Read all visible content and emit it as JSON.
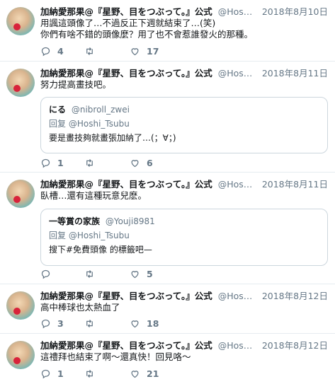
{
  "author": {
    "name": "加納愛那果@『星野、目をつぶって。』公式",
    "handle": "@Hos…"
  },
  "reply_prefix": "回复",
  "tweets": [
    {
      "date": "2018年8月10日",
      "text": "用諷這頭像了…不過反正下週就結束了…(笑)\n你們有啥不錯的頭像麼？用了也不會惹誰發火的那種。",
      "replies": "4",
      "retweets": "",
      "likes": "17"
    },
    {
      "date": "2018年8月11日",
      "text": "努力提高畫技吧。",
      "quote": {
        "name": "にる",
        "handle": "@nibroll_zwei",
        "reply_to": "@Hoshi_Tsubu",
        "text": "要是畫技夠就畫張加納了…(；∀；)"
      },
      "replies": "1",
      "retweets": "",
      "likes": "6"
    },
    {
      "date": "2018年8月11日",
      "text": "臥槽…還有這種玩意兒麽。",
      "quote": {
        "name": "一等賞の家族",
        "handle": "@Youji8981",
        "reply_to": "@Hoshi_Tsubu",
        "text": "搜下#免費頭像 的標籤吧—"
      },
      "replies": "",
      "retweets": "",
      "likes": "5"
    },
    {
      "date": "2018年8月12日",
      "text": "高中棒球也太熱血了",
      "replies": "3",
      "retweets": "",
      "likes": "18"
    },
    {
      "date": "2018年8月12日",
      "text": "這禮拜也結束了啊〜還真快！回見咯〜",
      "replies": "1",
      "retweets": "",
      "likes": "21"
    }
  ]
}
